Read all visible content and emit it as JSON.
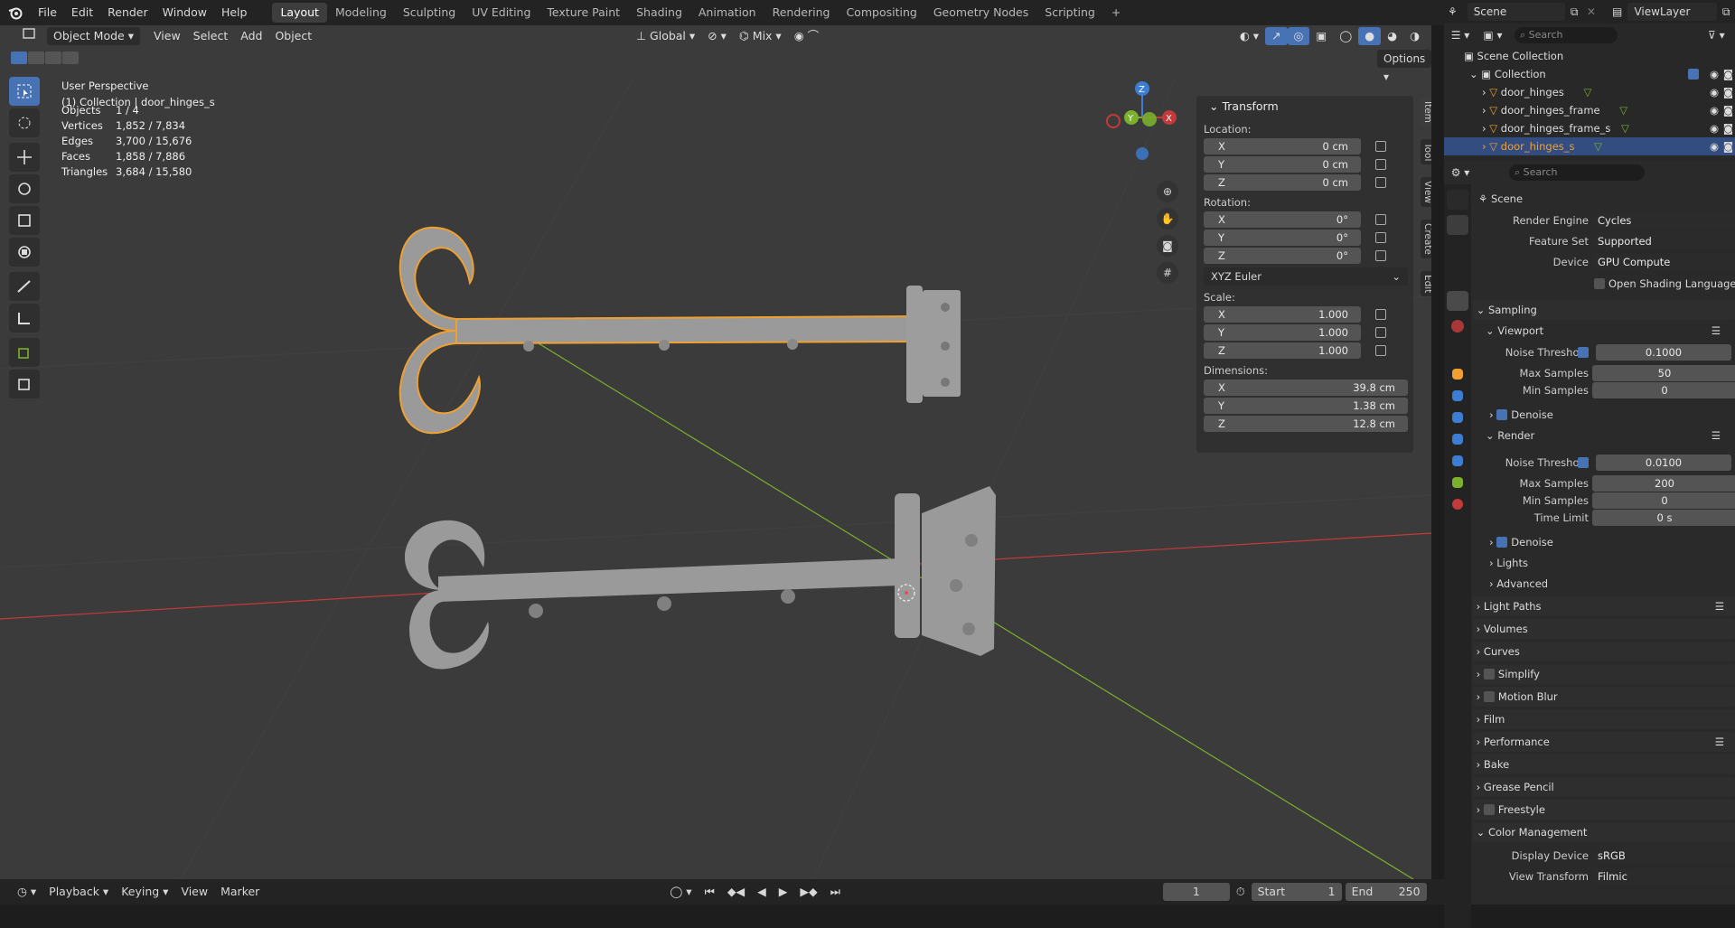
{
  "menu": {
    "file": "File",
    "edit": "Edit",
    "render": "Render",
    "window": "Window",
    "help": "Help"
  },
  "workspaces": [
    "Layout",
    "Modeling",
    "Sculpting",
    "UV Editing",
    "Texture Paint",
    "Shading",
    "Animation",
    "Rendering",
    "Compositing",
    "Geometry Nodes",
    "Scripting"
  ],
  "active_workspace": "Layout",
  "scene": {
    "name": "Scene",
    "view_layer": "ViewLayer"
  },
  "viewport_header": {
    "mode": "Object Mode",
    "view": "View",
    "select": "Select",
    "add": "Add",
    "object": "Object",
    "orientation": "Global",
    "snap_mix": "Mix",
    "options": "Options"
  },
  "overlay_info": {
    "perspective": "User Perspective",
    "collection": "(1) Collection | door_hinges_s",
    "stats": [
      {
        "k": "Objects",
        "v": "1 / 4"
      },
      {
        "k": "Vertices",
        "v": "1,852 / 7,834"
      },
      {
        "k": "Edges",
        "v": "3,700 / 15,676"
      },
      {
        "k": "Faces",
        "v": "1,858 / 7,886"
      },
      {
        "k": "Triangles",
        "v": "3,684 / 15,580"
      }
    ]
  },
  "gizmo": {
    "x": "X",
    "y": "Y",
    "z": "Z"
  },
  "npanel": {
    "title": "Transform",
    "location_label": "Location:",
    "location": [
      {
        "ax": "X",
        "v": "0 cm"
      },
      {
        "ax": "Y",
        "v": "0 cm"
      },
      {
        "ax": "Z",
        "v": "0 cm"
      }
    ],
    "rotation_label": "Rotation:",
    "rotation": [
      {
        "ax": "X",
        "v": "0°"
      },
      {
        "ax": "Y",
        "v": "0°"
      },
      {
        "ax": "Z",
        "v": "0°"
      }
    ],
    "rotation_mode": "XYZ Euler",
    "scale_label": "Scale:",
    "scale": [
      {
        "ax": "X",
        "v": "1.000"
      },
      {
        "ax": "Y",
        "v": "1.000"
      },
      {
        "ax": "Z",
        "v": "1.000"
      }
    ],
    "dimensions_label": "Dimensions:",
    "dimensions": [
      {
        "ax": "X",
        "v": "39.8 cm"
      },
      {
        "ax": "Y",
        "v": "1.38 cm"
      },
      {
        "ax": "Z",
        "v": "12.8 cm"
      }
    ],
    "tabs": [
      "Item",
      "Tool",
      "View",
      "Create",
      "Edit"
    ]
  },
  "timeline": {
    "playback": "Playback",
    "keying": "Keying",
    "view": "View",
    "marker": "Marker",
    "current_frame": "1",
    "start_label": "Start",
    "start": "1",
    "end_label": "End",
    "end": "250"
  },
  "outliner": {
    "search_placeholder": "Search",
    "scene_collection": "Scene Collection",
    "collection": "Collection",
    "items": [
      "door_hinges",
      "door_hinges_frame",
      "door_hinges_frame_s",
      "door_hinges_s"
    ],
    "selected": "door_hinges_s"
  },
  "properties": {
    "search_placeholder": "Search",
    "context": "Scene",
    "render_engine_label": "Render Engine",
    "render_engine": "Cycles",
    "feature_set_label": "Feature Set",
    "feature_set": "Supported",
    "device_label": "Device",
    "device": "GPU Compute",
    "osl": "Open Shading Language",
    "sampling": "Sampling",
    "viewport": "Viewport",
    "noise_threshold_label": "Noise Threshold",
    "vp_noise_threshold": "0.1000",
    "max_samples_label": "Max Samples",
    "vp_max_samples": "50",
    "min_samples_label": "Min Samples",
    "vp_min_samples": "0",
    "denoise": "Denoise",
    "render": "Render",
    "r_noise_threshold": "0.0100",
    "r_max_samples": "200",
    "r_min_samples": "0",
    "time_limit_label": "Time Limit",
    "r_time_limit": "0 s",
    "lights": "Lights",
    "advanced": "Advanced",
    "sections": [
      "Light Paths",
      "Volumes",
      "Curves",
      "Simplify",
      "Motion Blur",
      "Film",
      "Performance",
      "Bake",
      "Grease Pencil",
      "Freestyle",
      "Color Management"
    ],
    "display_device_label": "Display Device",
    "display_device": "sRGB",
    "view_transform_label": "View Transform",
    "view_transform": "Filmic"
  },
  "colors": {
    "accent": "#4772b3",
    "selection_outline": "#f0a030",
    "x_axis": "#c23a3a",
    "y_axis": "#7ab02c",
    "z_axis": "#3d7dd4"
  }
}
